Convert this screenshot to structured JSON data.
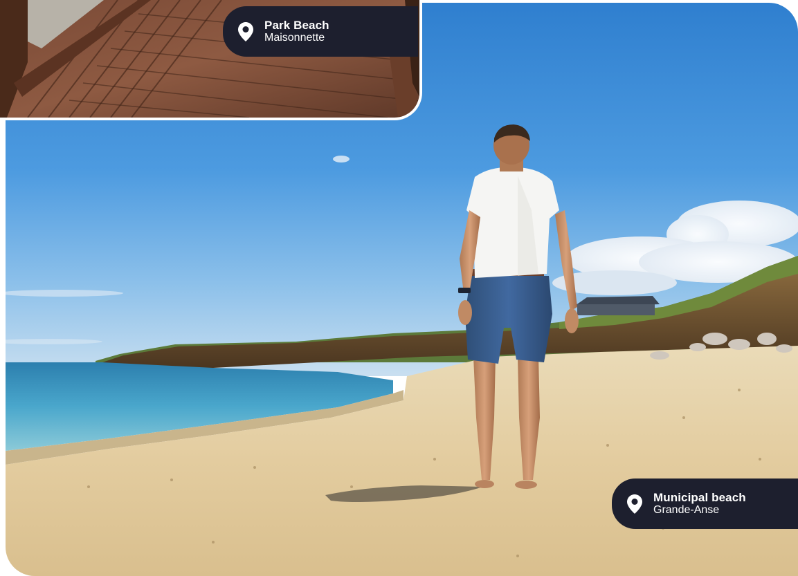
{
  "photos": {
    "main": {
      "subject": "beach-walker-photo"
    },
    "inset": {
      "subject": "boardwalk-photo"
    }
  },
  "locations": [
    {
      "name": "Park Beach",
      "place": "Maisonnette",
      "icon": "map-pin-icon"
    },
    {
      "name": "Municipal beach",
      "place": "Grande-Anse",
      "icon": "map-pin-icon"
    }
  ],
  "colors": {
    "tag_background": "#1d1f2e",
    "tag_text": "#ffffff",
    "sky": "#3a8fd6",
    "sand": "#e6d2aa",
    "sea": "#3f9ec4"
  }
}
